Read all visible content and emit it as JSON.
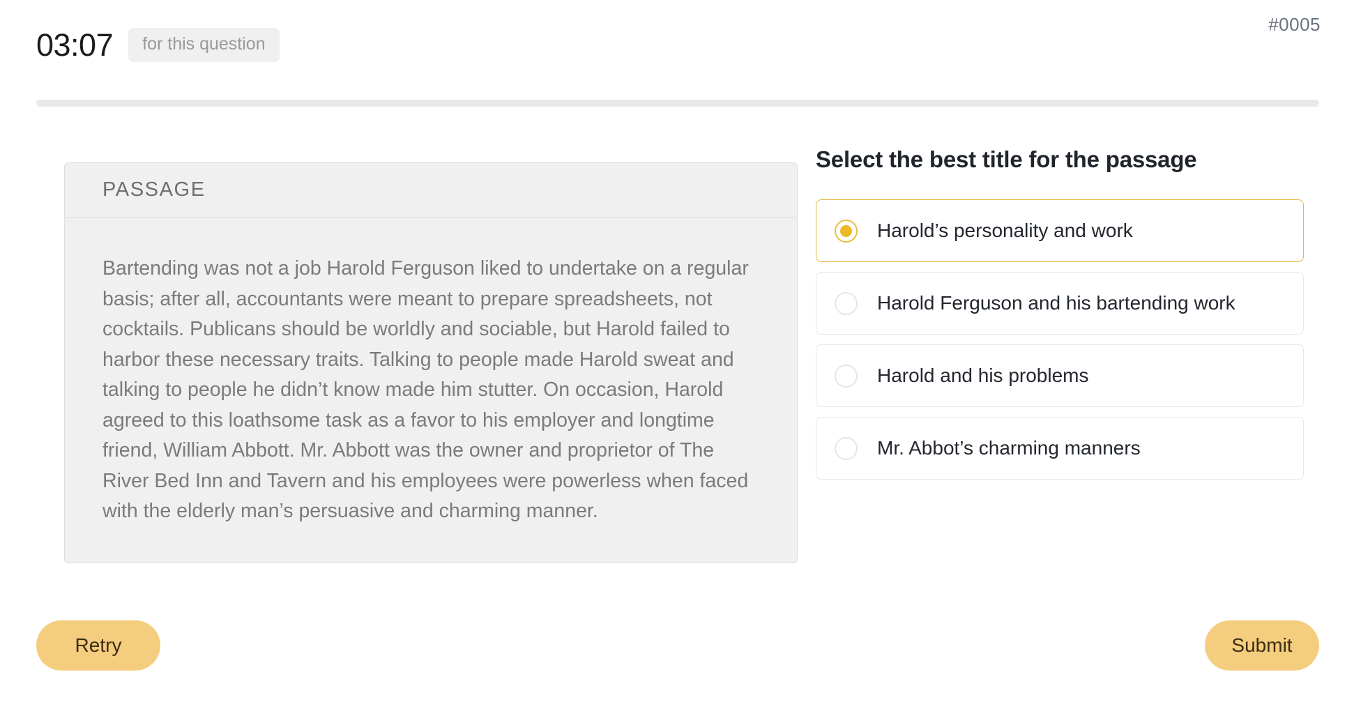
{
  "header": {
    "timer": "03:07",
    "timer_badge": "for this question",
    "question_id": "#0005",
    "progress_percent": 0
  },
  "passage_panel": {
    "header_label": "PASSAGE",
    "text": "Bartending was not a job Harold Ferguson liked to undertake on a regular basis; after all, accountants were meant to prepare spreadsheets, not cocktails. Publicans should be worldly and sociable, but Harold failed to harbor these necessary traits. Talking to people made Harold sweat and talking to people he didn’t know made him stutter. On occasion, Harold agreed to this loathsome task as a favor to his employer and longtime friend, William Abbott. Mr. Abbott was the owner and proprietor of The River Bed Inn and Tavern and his employees were powerless when faced with the elderly man’s persuasive and charming manner."
  },
  "question": {
    "title": "Select the best title for the passage",
    "options": [
      {
        "label": "Harold’s personality and work",
        "selected": true
      },
      {
        "label": "Harold Ferguson and his bartending work",
        "selected": false
      },
      {
        "label": "Harold and his problems",
        "selected": false
      },
      {
        "label": "Mr. Abbot’s charming manners",
        "selected": false
      }
    ]
  },
  "footer": {
    "retry_label": "Retry",
    "submit_label": "Submit"
  },
  "colors": {
    "accent": "#edb821",
    "selected_border": "#e3b73c",
    "button_bg": "#f5cd7e",
    "panel_bg": "#f0f0f0",
    "progress_track": "#e9e9e9"
  }
}
